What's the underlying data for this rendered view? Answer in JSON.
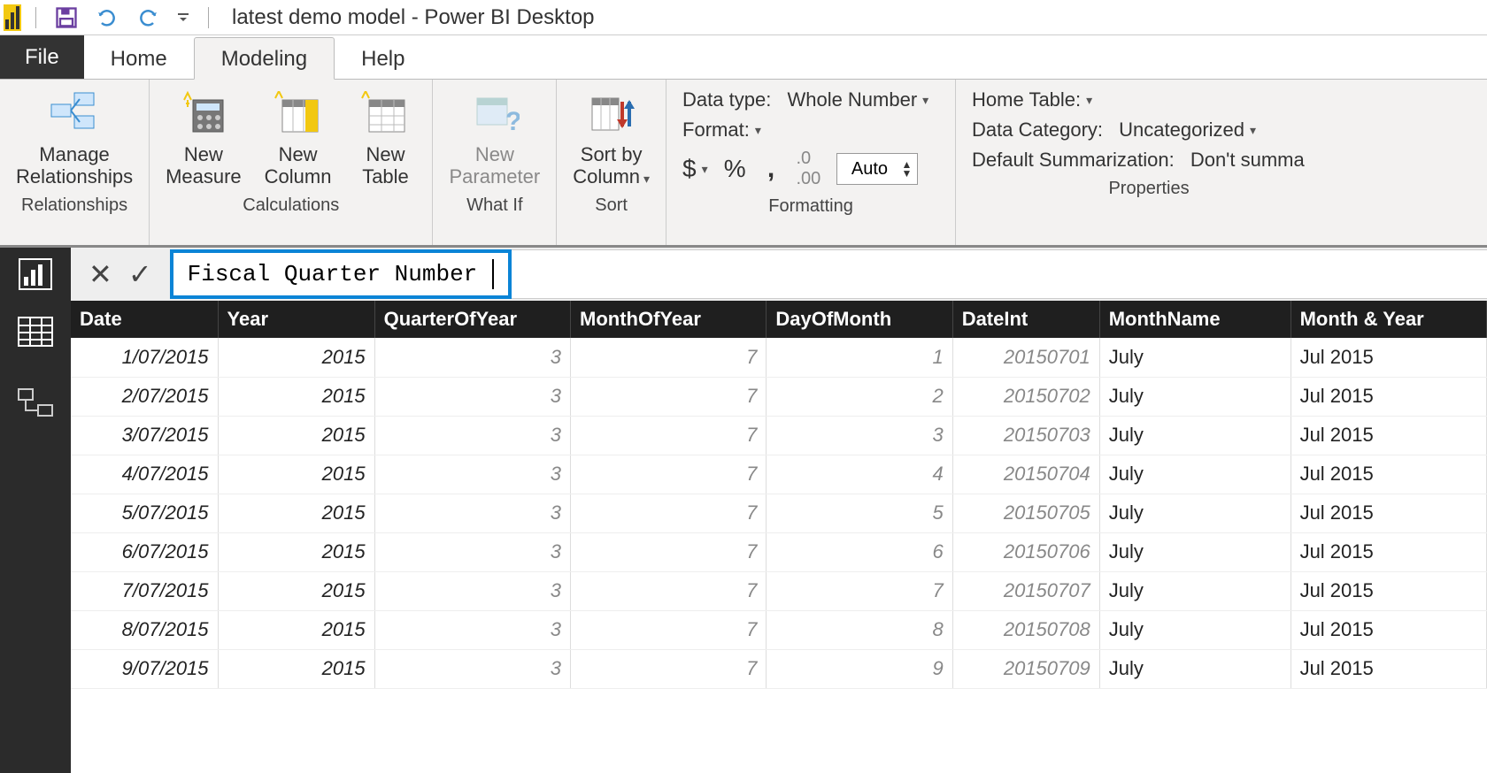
{
  "titlebar": {
    "doc_title": "latest demo model - Power BI Desktop"
  },
  "tabs": {
    "file": "File",
    "home": "Home",
    "modeling": "Modeling",
    "help": "Help",
    "active": "Modeling"
  },
  "ribbon": {
    "relationships": {
      "manage": "Manage\nRelationships",
      "group": "Relationships"
    },
    "calculations": {
      "new_measure": "New\nMeasure",
      "new_column": "New\nColumn",
      "new_table": "New\nTable",
      "group": "Calculations"
    },
    "whatif": {
      "new_parameter": "New\nParameter",
      "group": "What If"
    },
    "sort": {
      "sort_by_column": "Sort by\nColumn",
      "group": "Sort"
    },
    "formatting": {
      "data_type_label": "Data type:",
      "data_type_value": "Whole Number",
      "format_label": "Format:",
      "currency": "$",
      "percent": "%",
      "comma": ",",
      "decimals_icon": ".00",
      "decimals_value": "Auto",
      "group": "Formatting"
    },
    "properties": {
      "home_table_label": "Home Table:",
      "data_category_label": "Data Category:",
      "data_category_value": "Uncategorized",
      "default_sum_label": "Default Summarization:",
      "default_sum_value": "Don't summa",
      "group": "Properties"
    }
  },
  "formula": {
    "text": "Fiscal Quarter Number ="
  },
  "table": {
    "headers": [
      "Date",
      "Year",
      "QuarterOfYear",
      "MonthOfYear",
      "DayOfMonth",
      "DateInt",
      "MonthName",
      "Month & Year"
    ],
    "rows": [
      {
        "Date": "1/07/2015",
        "Year": "2015",
        "QuarterOfYear": "3",
        "MonthOfYear": "7",
        "DayOfMonth": "1",
        "DateInt": "20150701",
        "MonthName": "July",
        "MonthAndYear": "Jul 2015"
      },
      {
        "Date": "2/07/2015",
        "Year": "2015",
        "QuarterOfYear": "3",
        "MonthOfYear": "7",
        "DayOfMonth": "2",
        "DateInt": "20150702",
        "MonthName": "July",
        "MonthAndYear": "Jul 2015"
      },
      {
        "Date": "3/07/2015",
        "Year": "2015",
        "QuarterOfYear": "3",
        "MonthOfYear": "7",
        "DayOfMonth": "3",
        "DateInt": "20150703",
        "MonthName": "July",
        "MonthAndYear": "Jul 2015"
      },
      {
        "Date": "4/07/2015",
        "Year": "2015",
        "QuarterOfYear": "3",
        "MonthOfYear": "7",
        "DayOfMonth": "4",
        "DateInt": "20150704",
        "MonthName": "July",
        "MonthAndYear": "Jul 2015"
      },
      {
        "Date": "5/07/2015",
        "Year": "2015",
        "QuarterOfYear": "3",
        "MonthOfYear": "7",
        "DayOfMonth": "5",
        "DateInt": "20150705",
        "MonthName": "July",
        "MonthAndYear": "Jul 2015"
      },
      {
        "Date": "6/07/2015",
        "Year": "2015",
        "QuarterOfYear": "3",
        "MonthOfYear": "7",
        "DayOfMonth": "6",
        "DateInt": "20150706",
        "MonthName": "July",
        "MonthAndYear": "Jul 2015"
      },
      {
        "Date": "7/07/2015",
        "Year": "2015",
        "QuarterOfYear": "3",
        "MonthOfYear": "7",
        "DayOfMonth": "7",
        "DateInt": "20150707",
        "MonthName": "July",
        "MonthAndYear": "Jul 2015"
      },
      {
        "Date": "8/07/2015",
        "Year": "2015",
        "QuarterOfYear": "3",
        "MonthOfYear": "7",
        "DayOfMonth": "8",
        "DateInt": "20150708",
        "MonthName": "July",
        "MonthAndYear": "Jul 2015"
      },
      {
        "Date": "9/07/2015",
        "Year": "2015",
        "QuarterOfYear": "3",
        "MonthOfYear": "7",
        "DayOfMonth": "9",
        "DateInt": "20150709",
        "MonthName": "July",
        "MonthAndYear": "Jul 2015"
      }
    ]
  }
}
